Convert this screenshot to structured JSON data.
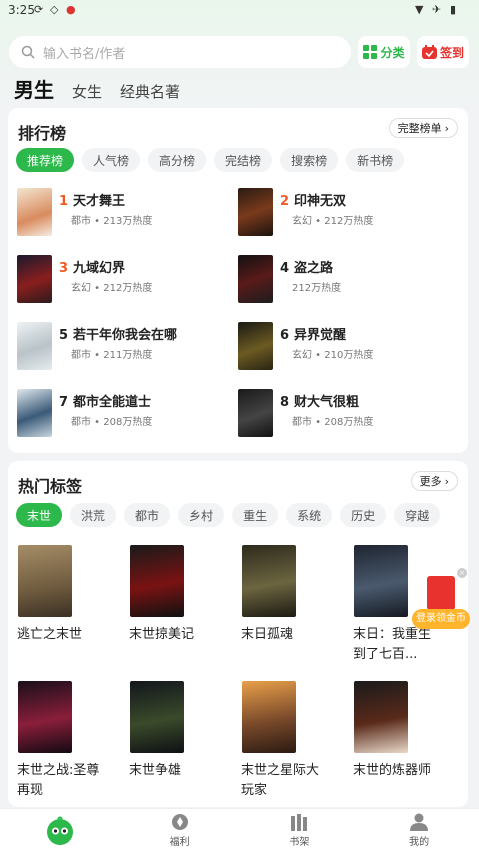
{
  "status": {
    "time": "3:25"
  },
  "search": {
    "placeholder": "输入书名/作者"
  },
  "header": {
    "category_label": "分类",
    "signin_label": "签到"
  },
  "gender_tabs": [
    "男生",
    "女生",
    "经典名著"
  ],
  "ranking": {
    "title": "排行榜",
    "more": "完整榜单",
    "tabs": [
      "推荐榜",
      "人气榜",
      "高分榜",
      "完结榜",
      "搜索榜",
      "新书榜"
    ],
    "items": [
      {
        "rank": "1",
        "name": "天才舞王",
        "meta": "都市 • 213万热度"
      },
      {
        "rank": "2",
        "name": "印神无双",
        "meta": "玄幻 • 212万热度"
      },
      {
        "rank": "3",
        "name": "九域幻界",
        "meta": "玄幻 • 212万热度"
      },
      {
        "rank": "4",
        "name": "盗之路",
        "meta": "212万热度"
      },
      {
        "rank": "5",
        "name": "若干年你我会在哪",
        "meta": "都市 • 211万热度"
      },
      {
        "rank": "6",
        "name": "异界觉醒",
        "meta": "玄幻 • 210万热度"
      },
      {
        "rank": "7",
        "name": "都市全能道士",
        "meta": "都市 • 208万热度"
      },
      {
        "rank": "8",
        "name": "财大气很粗",
        "meta": "都市 • 208万热度"
      }
    ]
  },
  "hot_tags": {
    "title": "热门标签",
    "more": "更多",
    "tabs": [
      "末世",
      "洪荒",
      "都市",
      "乡村",
      "重生",
      "系统",
      "历史",
      "穿越"
    ],
    "books": [
      {
        "title": "逃亡之末世"
      },
      {
        "title": "末世掠美记"
      },
      {
        "title": "末日孤魂"
      },
      {
        "title": "末日：我重生到了七百..."
      },
      {
        "title": "末世之战:圣尊再现"
      },
      {
        "title": "末世争雄"
      },
      {
        "title": "末世之星际大玩家"
      },
      {
        "title": "末世的炼器师"
      }
    ]
  },
  "gift": {
    "label": "登录领金币"
  },
  "bottom_nav": [
    "福利",
    "书架",
    "我的"
  ],
  "colors": {
    "accent": "#2db84b",
    "rank_highlight": "#f05a24",
    "signin": "#e8322e"
  }
}
